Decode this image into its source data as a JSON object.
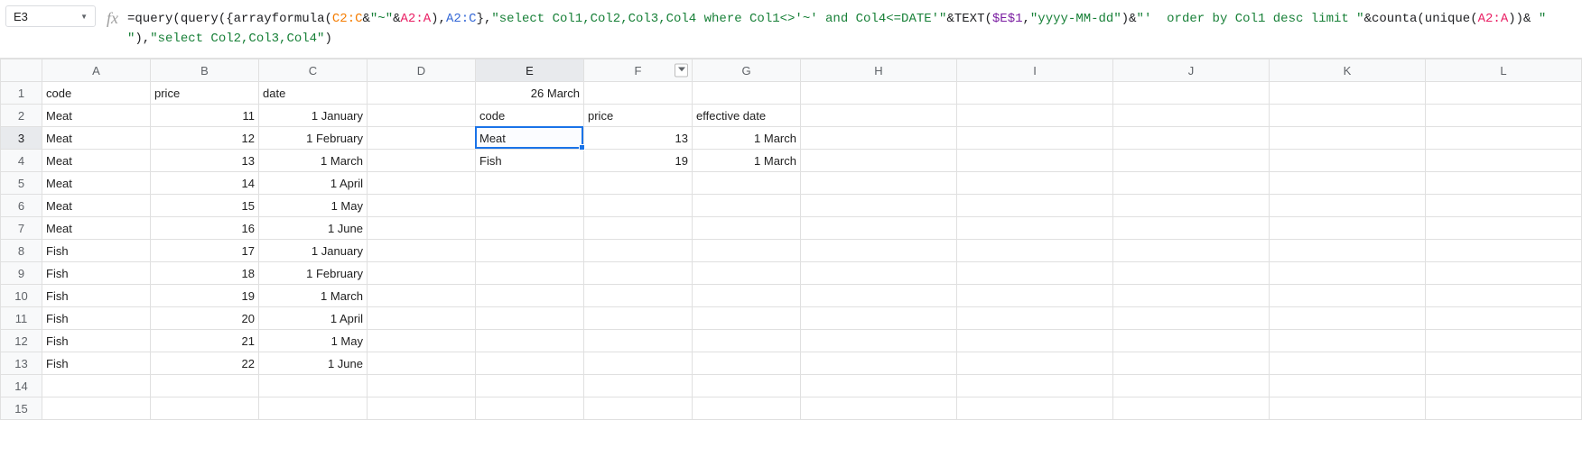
{
  "nameBox": "E3",
  "formula_segments": [
    {
      "cls": "t-black",
      "text": "="
    },
    {
      "cls": "t-black",
      "text": "query"
    },
    {
      "cls": "t-black",
      "text": "("
    },
    {
      "cls": "t-black",
      "text": "query"
    },
    {
      "cls": "t-black",
      "text": "({"
    },
    {
      "cls": "t-black",
      "text": "arrayformula"
    },
    {
      "cls": "t-black",
      "text": "("
    },
    {
      "cls": "t-range",
      "text": "C2:C"
    },
    {
      "cls": "t-black",
      "text": "&"
    },
    {
      "cls": "t-string",
      "text": "\"~\""
    },
    {
      "cls": "t-black",
      "text": "&"
    },
    {
      "cls": "t-range2",
      "text": "A2:A"
    },
    {
      "cls": "t-black",
      "text": "),"
    },
    {
      "cls": "t-range3",
      "text": "A2:C"
    },
    {
      "cls": "t-black",
      "text": "},"
    },
    {
      "cls": "t-string",
      "text": "\"select Col1,Col2,Col3,Col4 where Col1<>'~' and Col4<=DATE'\""
    },
    {
      "cls": "t-black",
      "text": "&TEXT("
    },
    {
      "cls": "t-ref",
      "text": "$E$1"
    },
    {
      "cls": "t-black",
      "text": ","
    },
    {
      "cls": "t-string",
      "text": "\"yyyy-MM-dd\""
    },
    {
      "cls": "t-black",
      "text": ")&"
    },
    {
      "cls": "t-string",
      "text": "\"'  order by Col1 desc limit \""
    },
    {
      "cls": "t-black",
      "text": "&counta(unique("
    },
    {
      "cls": "t-range2",
      "text": "A2:A"
    },
    {
      "cls": "t-black",
      "text": "))& "
    },
    {
      "cls": "t-string",
      "text": "\" \""
    },
    {
      "cls": "t-black",
      "text": "),"
    },
    {
      "cls": "t-string",
      "text": "\"select Col2,Col3,Col4\""
    },
    {
      "cls": "t-black",
      "text": ")"
    }
  ],
  "columns": [
    "A",
    "B",
    "C",
    "D",
    "E",
    "F",
    "G",
    "H",
    "I",
    "J",
    "K",
    "L"
  ],
  "rowCount": 15,
  "activeCell": {
    "row": 3,
    "col": "E"
  },
  "filterColumn": "F",
  "cells": {
    "A1": {
      "v": "code",
      "a": "left"
    },
    "B1": {
      "v": "price",
      "a": "left"
    },
    "C1": {
      "v": "date",
      "a": "left"
    },
    "E1": {
      "v": "26 March",
      "a": "right"
    },
    "A2": {
      "v": "Meat",
      "a": "left"
    },
    "B2": {
      "v": "11",
      "a": "right"
    },
    "C2": {
      "v": "1 January",
      "a": "right"
    },
    "E2": {
      "v": "code",
      "a": "left"
    },
    "F2": {
      "v": "price",
      "a": "left"
    },
    "G2": {
      "v": "effective date",
      "a": "left"
    },
    "A3": {
      "v": "Meat",
      "a": "left"
    },
    "B3": {
      "v": "12",
      "a": "right"
    },
    "C3": {
      "v": "1 February",
      "a": "right"
    },
    "E3": {
      "v": "Meat",
      "a": "left"
    },
    "F3": {
      "v": "13",
      "a": "right"
    },
    "G3": {
      "v": "1 March",
      "a": "right"
    },
    "A4": {
      "v": "Meat",
      "a": "left"
    },
    "B4": {
      "v": "13",
      "a": "right"
    },
    "C4": {
      "v": "1 March",
      "a": "right"
    },
    "E4": {
      "v": "Fish",
      "a": "left"
    },
    "F4": {
      "v": "19",
      "a": "right"
    },
    "G4": {
      "v": "1 March",
      "a": "right"
    },
    "A5": {
      "v": "Meat",
      "a": "left"
    },
    "B5": {
      "v": "14",
      "a": "right"
    },
    "C5": {
      "v": "1 April",
      "a": "right"
    },
    "A6": {
      "v": "Meat",
      "a": "left"
    },
    "B6": {
      "v": "15",
      "a": "right"
    },
    "C6": {
      "v": "1 May",
      "a": "right"
    },
    "A7": {
      "v": "Meat",
      "a": "left"
    },
    "B7": {
      "v": "16",
      "a": "right"
    },
    "C7": {
      "v": "1 June",
      "a": "right"
    },
    "A8": {
      "v": "Fish",
      "a": "left"
    },
    "B8": {
      "v": "17",
      "a": "right"
    },
    "C8": {
      "v": "1 January",
      "a": "right"
    },
    "A9": {
      "v": "Fish",
      "a": "left"
    },
    "B9": {
      "v": "18",
      "a": "right"
    },
    "C9": {
      "v": "1 February",
      "a": "right"
    },
    "A10": {
      "v": "Fish",
      "a": "left"
    },
    "B10": {
      "v": "19",
      "a": "right"
    },
    "C10": {
      "v": "1 March",
      "a": "right"
    },
    "A11": {
      "v": "Fish",
      "a": "left"
    },
    "B11": {
      "v": "20",
      "a": "right"
    },
    "C11": {
      "v": "1 April",
      "a": "right"
    },
    "A12": {
      "v": "Fish",
      "a": "left"
    },
    "B12": {
      "v": "21",
      "a": "right"
    },
    "C12": {
      "v": "1 May",
      "a": "right"
    },
    "A13": {
      "v": "Fish",
      "a": "left"
    },
    "B13": {
      "v": "22",
      "a": "right"
    },
    "C13": {
      "v": "1 June",
      "a": "right"
    }
  }
}
